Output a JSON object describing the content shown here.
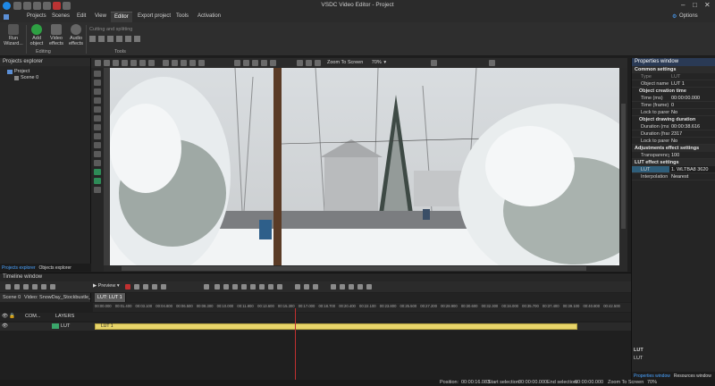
{
  "window": {
    "title": "VSDC Video Editor - Project",
    "options_label": "Options"
  },
  "menu": {
    "items": [
      "Projects",
      "Scenes",
      "Edit",
      "View",
      "Editor",
      "Export project",
      "Tools",
      "Activation"
    ],
    "active": "Editor"
  },
  "ribbon": {
    "run_wizard": "Run Wizard...",
    "add_object": "Add object",
    "video_effects": "Video effects",
    "audio_effects": "Audio effects",
    "editing_group": "Editing",
    "cutting_splitting": "Cutting and splitting",
    "tools_group": "Tools"
  },
  "projects_explorer": {
    "title": "Projects explorer",
    "tree": {
      "project": "Project",
      "scene": "Scene 0"
    },
    "tabs": [
      "Projects explorer",
      "Objects explorer"
    ]
  },
  "canvas_toolbar": {
    "zoom_label": "Zoom To Screen",
    "zoom_value": "70%"
  },
  "properties": {
    "title": "Properties window",
    "common_settings": "Common settings",
    "type_label": "Type",
    "type_value": "LUT",
    "object_name_label": "Object name",
    "object_name_value": "LUT 1",
    "object_creation_time": "Object creation time",
    "time_ms_label": "Time (ms)",
    "time_ms_value": "00:00:00.000",
    "time_frame_label": "Time (frame)",
    "time_frame_value": "0",
    "lock_parent_label": "Lock to parent",
    "lock_parent_value": "No",
    "object_drawing_duration": "Object drawing duration",
    "duration_ms_label": "Duration (ms)",
    "duration_ms_value": "00:00:38.616",
    "duration_frames_label": "Duration (frames)",
    "duration_frames_value": "2317",
    "lock_parent2_label": "Lock to parent",
    "lock_parent2_value": "No",
    "adjustments_effect_settings": "Adjustments effect settings",
    "transparency_label": "Transparency (%)",
    "transparency_value": "100",
    "lut_effect_settings": "LUT effect settings",
    "lut_label": "LUT",
    "lut_value": "1. WLTBA8 3620",
    "interpolation_label": "Interpolation",
    "interpolation_value": "Nearest",
    "footer_title": "LUT",
    "footer_desc": "LUT",
    "tabs": [
      "Properties window",
      "Resources window"
    ]
  },
  "timeline": {
    "title": "Timeline window",
    "preview_label": "Preview",
    "tabs": [
      "Scene 0",
      "Video: SnowDay_Stockbustle_1",
      "LUT: LUT 1"
    ],
    "ticks": [
      "00:00.000",
      "00:01.400",
      "00:03.100",
      "00:04.800",
      "00:06.500",
      "00:08.300",
      "00:10.000",
      "00:11.800",
      "00:13.600",
      "00:15.300",
      "00:17.000",
      "00:18.700",
      "00:20.400",
      "00:22.100",
      "00:23.800",
      "00:25.500",
      "00:27.200",
      "00:28.900",
      "00:30.600",
      "00:32.300",
      "00:34.000",
      "00:35.700",
      "00:37.400",
      "00:39.100",
      "00:40.800",
      "00:42.500"
    ],
    "layers_col": "COM...",
    "layers_label": "LAYERS",
    "track_name": "LUT",
    "clip_name": "LUT 1"
  },
  "status": {
    "position_label": "Position:",
    "position_value": "00:00:16.083",
    "start_sel_label": "Start selection:",
    "start_sel_value": "00:00:00.000",
    "end_sel_label": "End selection:",
    "end_sel_value": "00:00:00.000",
    "zoom_label": "Zoom To Screen",
    "zoom_value": "70%"
  }
}
